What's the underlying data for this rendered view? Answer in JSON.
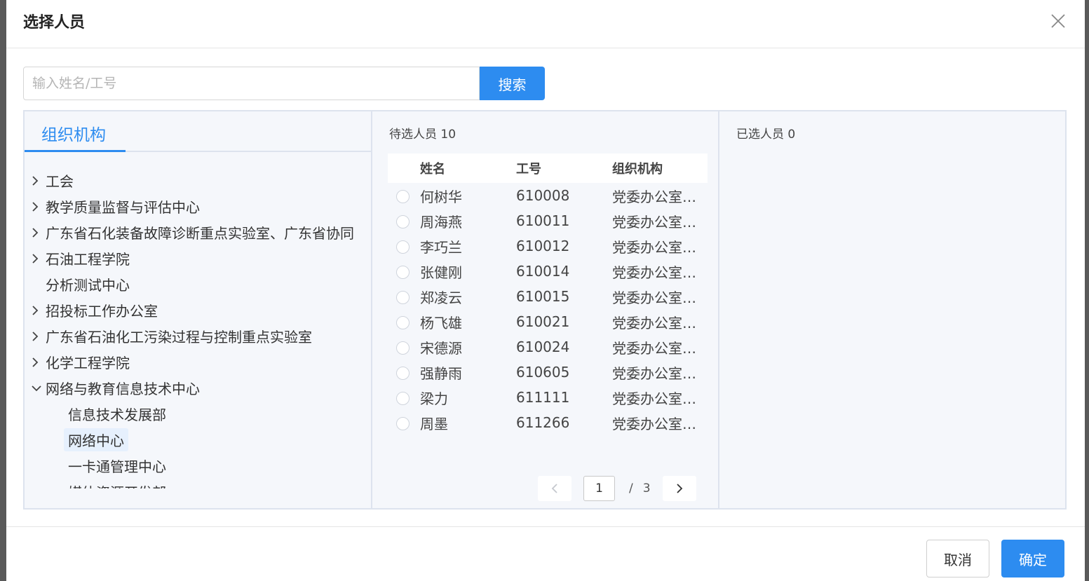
{
  "dialog": {
    "title": "选择人员",
    "close_icon": "close-icon"
  },
  "search": {
    "placeholder": "输入姓名/工号",
    "value": "",
    "button_label": "搜索"
  },
  "org_panel": {
    "tab_label": "组织机构",
    "nodes": [
      {
        "label": "工会",
        "expandable": true
      },
      {
        "label": "教学质量监督与评估中心",
        "expandable": true
      },
      {
        "label": "广东省石化装备故障诊断重点实验室、广东省协同",
        "expandable": true
      },
      {
        "label": "石油工程学院",
        "expandable": true
      },
      {
        "label": "分析测试中心",
        "expandable": false
      },
      {
        "label": "招投标工作办公室",
        "expandable": true
      },
      {
        "label": "广东省石油化工污染过程与控制重点实验室",
        "expandable": true
      },
      {
        "label": "化学工程学院",
        "expandable": true
      },
      {
        "label": "网络与教育信息技术中心",
        "expandable": true,
        "expanded": true
      }
    ],
    "children": [
      {
        "label": "信息技术发展部"
      },
      {
        "label": "网络中心",
        "active": true
      },
      {
        "label": "一卡通管理中心"
      },
      {
        "label": "媒体资源开发部"
      }
    ]
  },
  "candidates": {
    "title": "待选人员 10",
    "columns": [
      "姓名",
      "工号",
      "组织机构"
    ],
    "rows": [
      {
        "name": "何树华",
        "id": "610008",
        "org": "党委办公室…"
      },
      {
        "name": "周海燕",
        "id": "610011",
        "org": "党委办公室…"
      },
      {
        "name": "李巧兰",
        "id": "610012",
        "org": "党委办公室…"
      },
      {
        "name": "张健刚",
        "id": "610014",
        "org": "党委办公室…"
      },
      {
        "name": "郑凌云",
        "id": "610015",
        "org": "党委办公室…"
      },
      {
        "name": "杨飞雄",
        "id": "610021",
        "org": "党委办公室…"
      },
      {
        "name": "宋德源",
        "id": "610024",
        "org": "党委办公室…"
      },
      {
        "name": "强静雨",
        "id": "610605",
        "org": "党委办公室…"
      },
      {
        "name": "梁力",
        "id": "611111",
        "org": "党委办公室…"
      },
      {
        "name": "周墨",
        "id": "611266",
        "org": "党委办公室…"
      }
    ],
    "pager": {
      "current": "1",
      "separator": "/",
      "total": "3"
    }
  },
  "selected": {
    "title": "已选人员 0"
  },
  "footer": {
    "cancel_label": "取消",
    "ok_label": "确定"
  },
  "colors": {
    "accent": "#2d8cf0",
    "panel_bg": "#f5f7fb",
    "border": "#dde3ee"
  }
}
